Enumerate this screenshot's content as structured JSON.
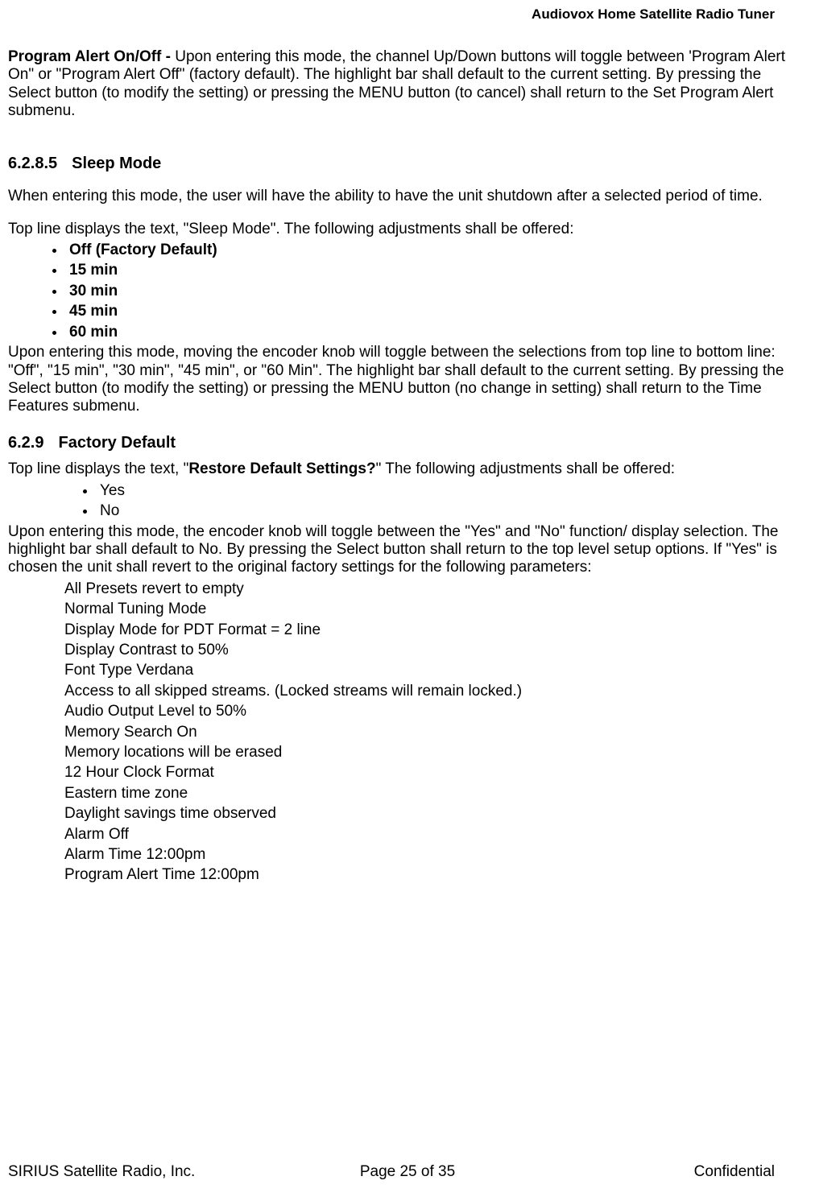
{
  "header": {
    "title": "Audiovox Home Satellite Radio Tuner"
  },
  "p1": {
    "lead": "Program Alert On/Off - ",
    "body": "Upon entering this mode, the channel Up/Down buttons will toggle between 'Program Alert On\" or \"Program Alert Off\" (factory default).  The highlight bar shall default to the current setting.  By pressing the Select button (to modify the setting) or pressing the MENU button (to cancel) shall return to the Set Program Alert submenu."
  },
  "s1": {
    "num": "6.2.8.5",
    "title": "Sleep Mode"
  },
  "p2": "When entering this mode, the user will have the ability to have the unit shutdown after a selected period of time.",
  "p3": "Top line displays the text, \"Sleep Mode\". The following adjustments shall be offered:",
  "sleep_opts": [
    "Off (Factory Default)",
    "15 min",
    "30 min",
    "45 min",
    "60 min"
  ],
  "p4": "Upon entering this mode, moving the encoder knob will toggle between the selections from top line to bottom line: \"Off\", \"15 min\", \"30 min\", \"45 min\", or \"60 Min\".  The highlight bar shall default to the current setting.  By pressing the Select button (to modify the setting) or pressing the MENU button (no change in setting) shall return to the Time Features submenu.",
  "s2": {
    "num": "6.2.9",
    "title": "Factory Default"
  },
  "p5": {
    "a": "Top line displays the text, \"",
    "b": "Restore Default Settings?",
    "c": "\" The following adjustments shall be offered:"
  },
  "yn": [
    "Yes",
    "No"
  ],
  "p6": "Upon entering this mode, the encoder knob will toggle between the \"Yes\" and \"No\" function/ display selection.  The highlight bar shall default to No.  By pressing the Select button shall return to the top level setup options.  If \"Yes\" is chosen the unit shall revert to the original factory settings for the following parameters:",
  "defaults": [
    "All Presets revert to empty",
    "Normal Tuning Mode",
    "Display Mode for PDT Format = 2 line",
    "Display Contrast to 50%",
    "Font Type Verdana",
    "Access to all skipped streams. (Locked streams will remain locked.)",
    "Audio Output Level to 50%",
    "Memory Search On",
    "Memory locations will be erased",
    "12 Hour Clock Format",
    "Eastern time zone",
    "Daylight savings time observed",
    "Alarm Off",
    "Alarm Time 12:00pm",
    "Program Alert Time 12:00pm"
  ],
  "footer": {
    "left": "SIRIUS Satellite Radio, Inc.",
    "center": "Page 25 of 35",
    "right": "Confidential"
  }
}
